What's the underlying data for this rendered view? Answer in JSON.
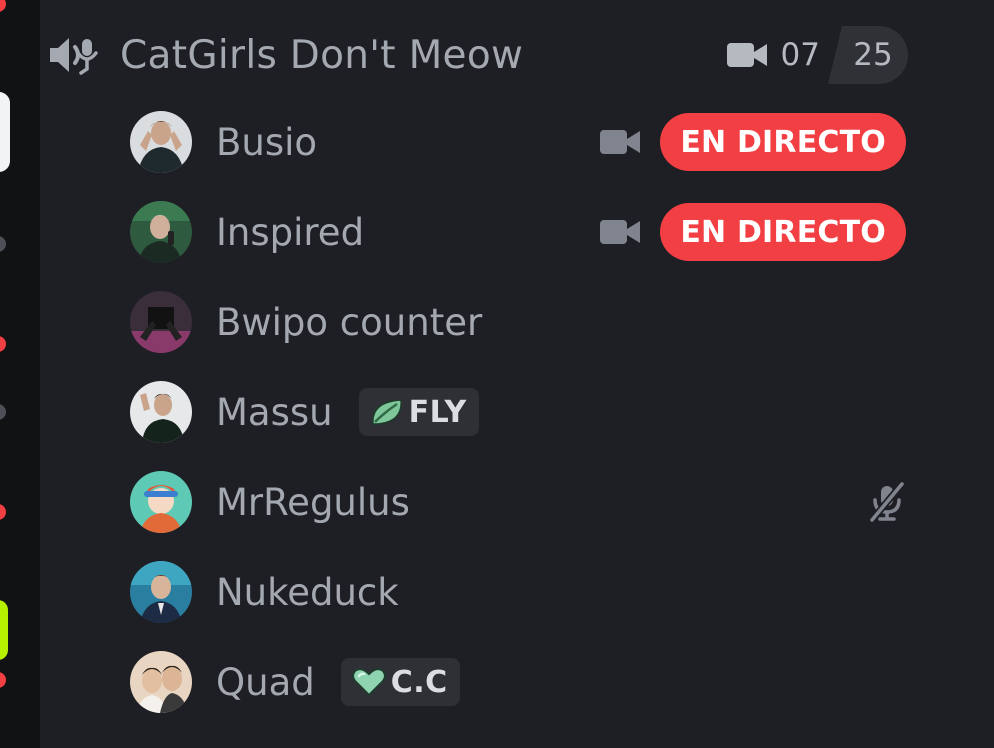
{
  "channel": {
    "name": "CatGirls Don't Meow",
    "user_count": "07",
    "user_limit": "25",
    "icon": "voice-speaker-icon",
    "camera_icon": "video-camera-icon"
  },
  "members": [
    {
      "name": "Busio",
      "live": true,
      "live_label": "EN DIRECTO",
      "video": true
    },
    {
      "name": "Inspired",
      "live": true,
      "live_label": "EN DIRECTO",
      "video": true
    },
    {
      "name": "Bwipo counter"
    },
    {
      "name": "Massu",
      "tag": {
        "text": "FLY",
        "icon": "leaf-icon"
      }
    },
    {
      "name": "MrRegulus",
      "muted": true,
      "muted_icon": "mic-muted-icon"
    },
    {
      "name": "Nukeduck"
    },
    {
      "name": "Quad",
      "tag": {
        "text": "C.C",
        "icon": "heart-icon"
      }
    }
  ],
  "colors": {
    "background": "#1e1f24",
    "live_badge": "#f23f43",
    "text_muted": "#a4a9b1"
  }
}
